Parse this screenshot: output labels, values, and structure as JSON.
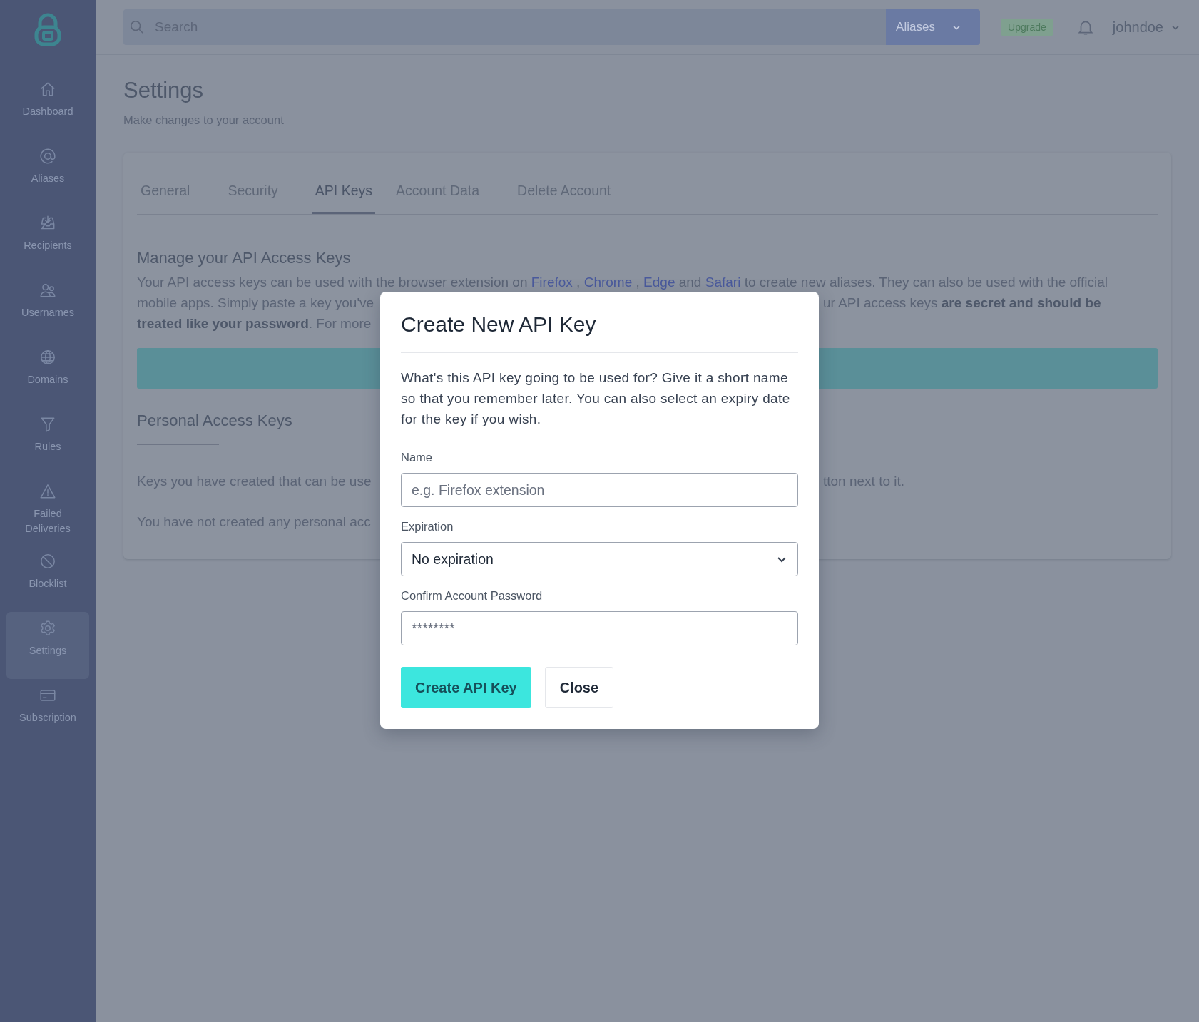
{
  "sidebar": {
    "items": [
      {
        "label": "Dashboard",
        "selected": false
      },
      {
        "label": "Aliases",
        "selected": false
      },
      {
        "label": "Recipients",
        "selected": false
      },
      {
        "label": "Usernames",
        "selected": false
      },
      {
        "label": "Domains",
        "selected": false
      },
      {
        "label": "Rules",
        "selected": false
      },
      {
        "label": "Failed Deliveries",
        "selected": false
      },
      {
        "label": "Blocklist",
        "selected": false
      },
      {
        "label": "Settings",
        "selected": true
      },
      {
        "label": "Subscription",
        "selected": false
      }
    ]
  },
  "topbar": {
    "search": {
      "placeholder": "Search"
    },
    "scope_button": "Aliases",
    "upgrade": "Upgrade",
    "user": "johndoe"
  },
  "page": {
    "title": "Settings",
    "subtitle": "Make changes to your account"
  },
  "tabs": [
    {
      "label": "General",
      "selected": false
    },
    {
      "label": "Security",
      "selected": false
    },
    {
      "label": "API Keys",
      "selected": true
    },
    {
      "label": "Account Data",
      "selected": false
    },
    {
      "label": "Delete Account",
      "selected": false
    }
  ],
  "api_section": {
    "heading": "Manage your API Access Keys",
    "first_line": [
      {
        "kind": "text",
        "text": "Your API access keys can be used with the browser extension on "
      },
      {
        "kind": "link",
        "text": "Firefox"
      },
      {
        "kind": "text",
        "text": " , "
      },
      {
        "kind": "link",
        "text": "Chrome"
      },
      {
        "kind": "text",
        "text": " , "
      },
      {
        "kind": "link",
        "text": "Edge"
      },
      {
        "kind": "text",
        "text": " and "
      },
      {
        "kind": "link",
        "text": "Safari"
      },
      {
        "kind": "text",
        "text": " to create new aliases. They can also be used with the official"
      }
    ],
    "partial_lines": [
      {
        "left": "mobile apps. Simply paste a key you've",
        "right": "ur API access keys **are secret and should be**"
      },
      {
        "left": "**treated like your password**. For more"
      }
    ]
  },
  "personal_keys": {
    "heading": "Personal Access Keys",
    "partial_lines": [
      {
        "left": "Keys you have created that can be use",
        "right": "tton next to it."
      },
      {
        "left": "You have not created any personal acc"
      }
    ]
  },
  "modal": {
    "title": "Create New API Key",
    "description": "What's this API key going to be used for? Give it a short name so that you remember later. You can also select an expiry date for the key if you wish.",
    "fields": [
      {
        "kind": "input",
        "label": "Name",
        "placeholder": "e.g. Firefox extension"
      },
      {
        "kind": "select",
        "label": "Expiration",
        "value": "No expiration"
      },
      {
        "kind": "input",
        "label": "Confirm Account Password",
        "placeholder": "********"
      }
    ],
    "buttons": [
      {
        "kind": "primary",
        "label": "Create API Key"
      },
      {
        "kind": "secondary",
        "label": "Close"
      }
    ]
  }
}
